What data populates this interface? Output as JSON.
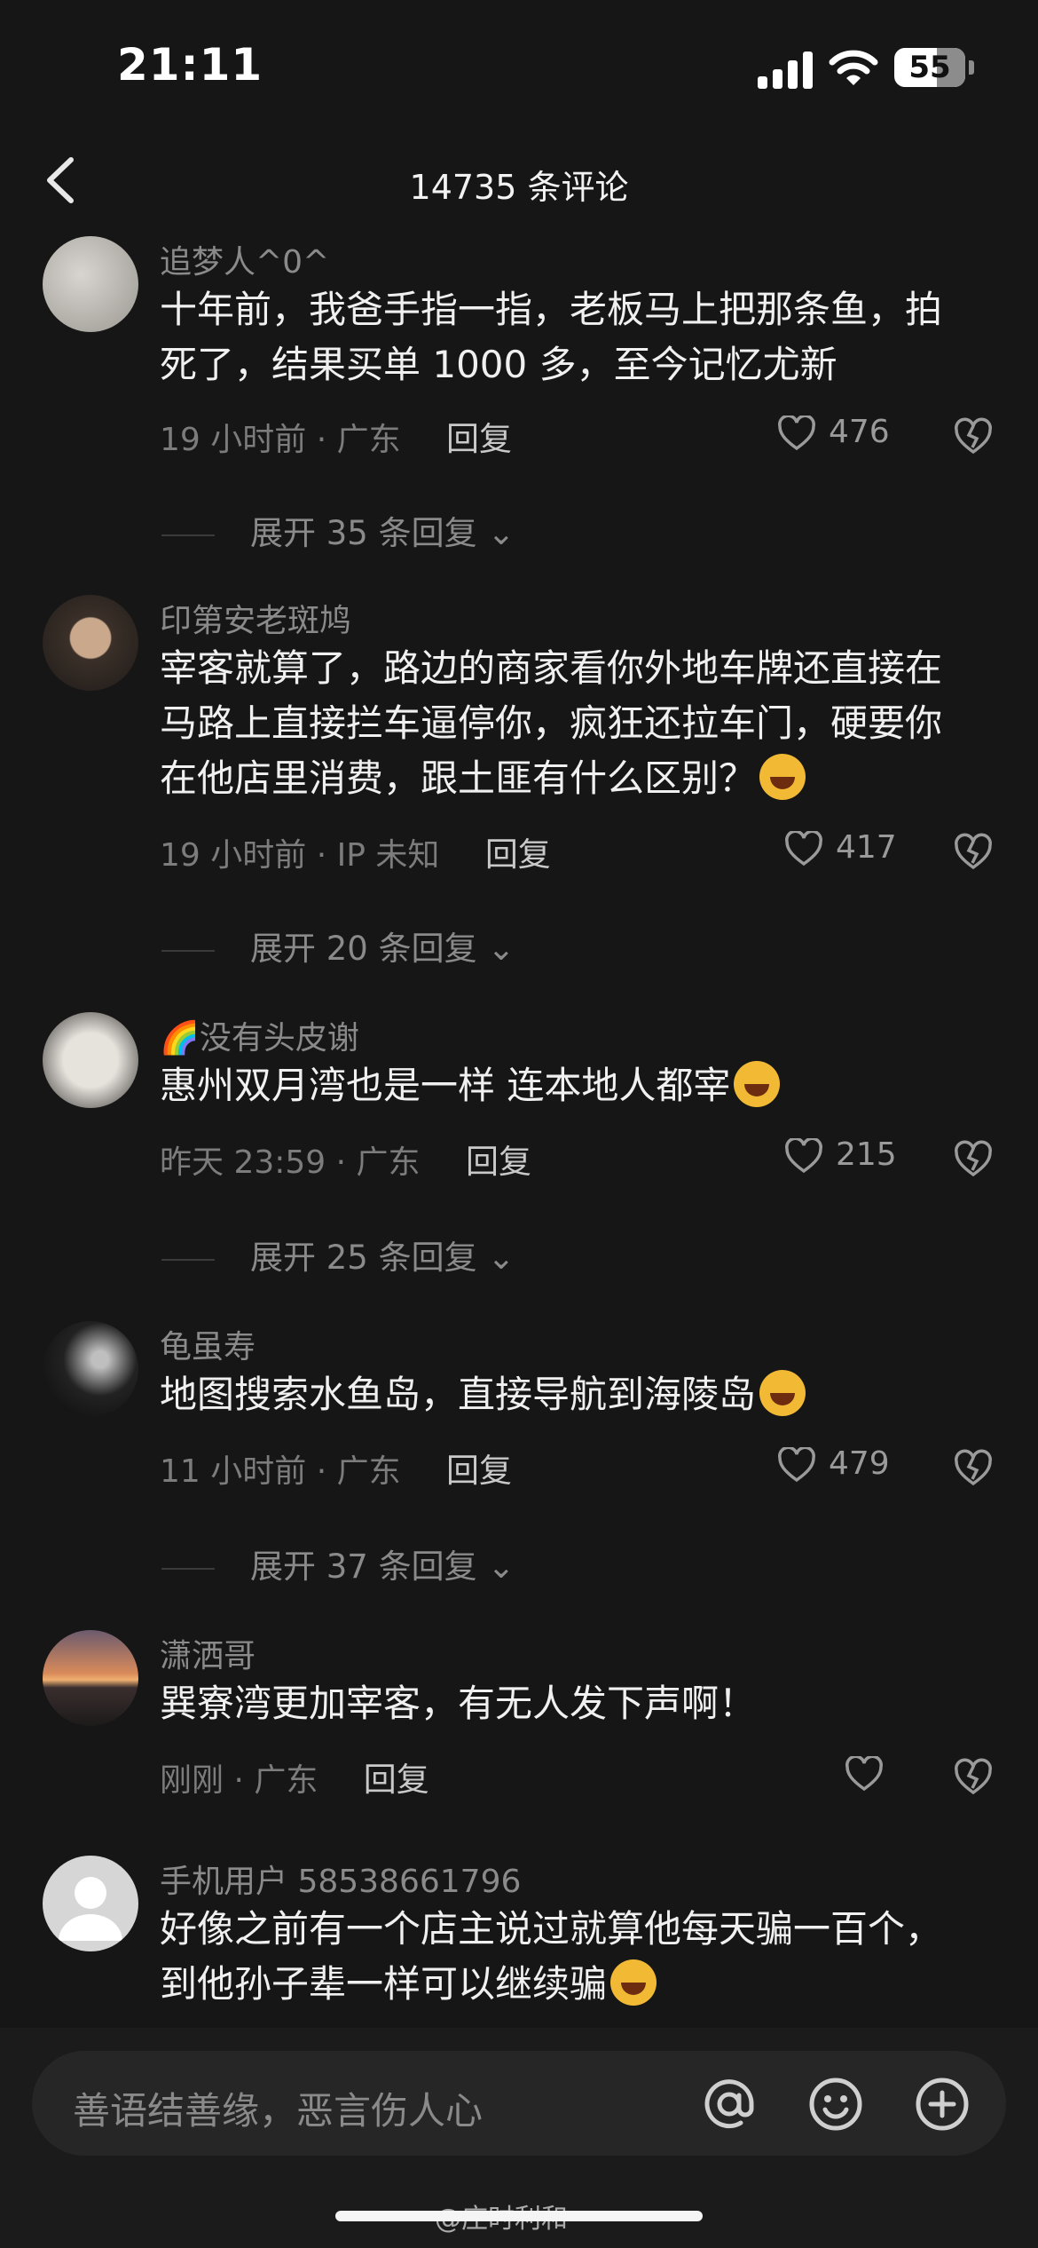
{
  "status_bar": {
    "time": "21:11",
    "battery": "55"
  },
  "header": {
    "title": "14735 条评论"
  },
  "comments": [
    {
      "user": "追梦人^0^",
      "text": "十年前，我爸手指一指，老板马上把那条鱼，拍死了，结果买单 1000 多，至今记忆尤新",
      "meta": "19 小时前 · 广东",
      "reply": "回复",
      "likes": "476",
      "expand": "展开 35 条回复"
    },
    {
      "user": "印第安老斑鸠",
      "text": "宰客就算了，路边的商家看你外地车牌还直接在马路上直接拦车逼停你，疯狂还拉车门，硬要你在他店里消费，跟土匪有什么区别？",
      "meta": "19 小时前 · IP 未知",
      "reply": "回复",
      "likes": "417",
      "expand": "展开 20 条回复"
    },
    {
      "user": "🌈没有头皮谢",
      "text": "惠州双月湾也是一样 连本地人都宰",
      "meta": "昨天 23:59 · 广东",
      "reply": "回复",
      "likes": "215",
      "expand": "展开 25 条回复"
    },
    {
      "user": "龟虽寿",
      "text": "地图搜索水鱼岛，直接导航到海陵岛",
      "meta": "11 小时前 · 广东",
      "reply": "回复",
      "likes": "479",
      "expand": "展开 37 条回复"
    },
    {
      "user": "潇洒哥",
      "text": "巽寮湾更加宰客，有无人发下声啊！",
      "meta": "刚刚 · 广东",
      "reply": "回复",
      "likes": "",
      "expand": ""
    },
    {
      "user": "手机用户 58538661796",
      "text": "好像之前有一个店主说过就算他每天骗一百个，到他孙子辈一样可以继续骗",
      "meta": "",
      "reply": "",
      "likes": "",
      "expand": ""
    }
  ],
  "input": {
    "placeholder": "善语结善缘，恶言伤人心"
  },
  "watermark": "@庄时利和",
  "icons": [
    "back-arrow-icon",
    "heart-icon",
    "broken-heart-icon",
    "at-icon",
    "emoji-icon",
    "plus-icon",
    "chevron-down-icon"
  ]
}
